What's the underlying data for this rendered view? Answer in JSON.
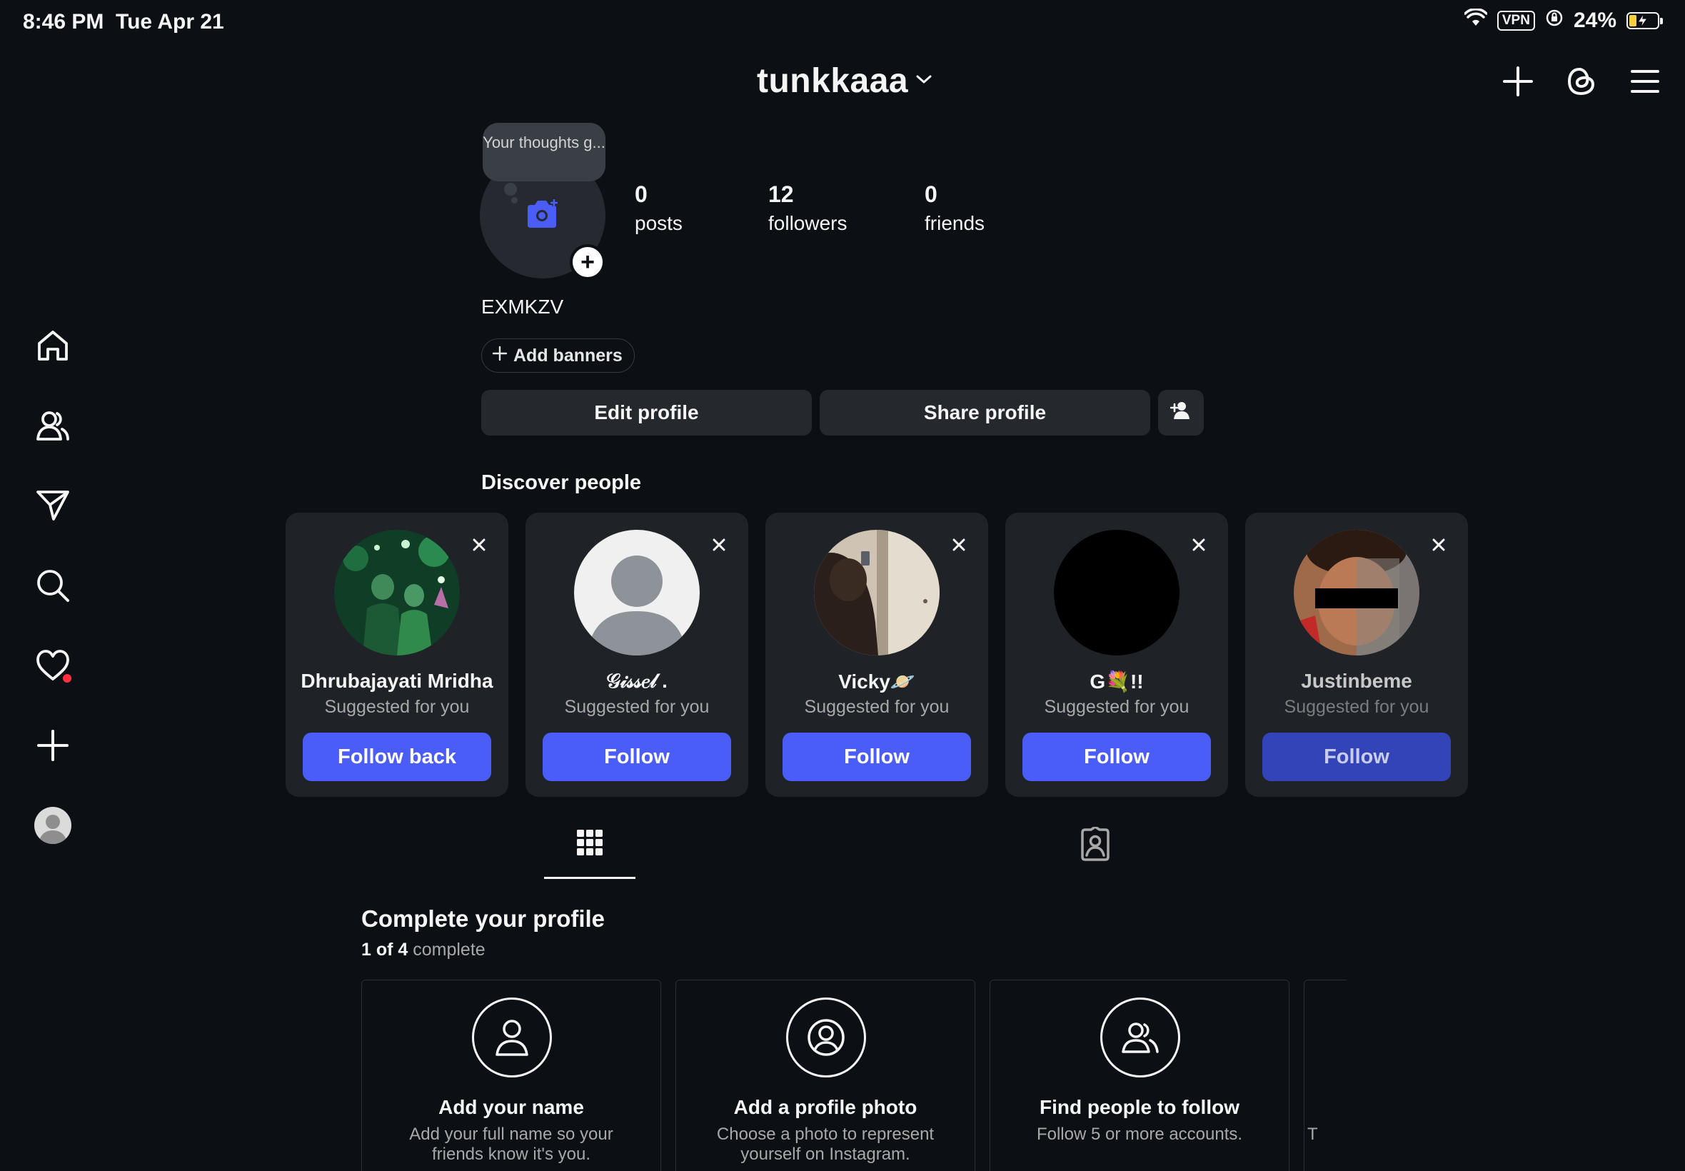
{
  "status_bar": {
    "time": "8:46 PM",
    "date": "Tue Apr 21",
    "vpn_label": "VPN",
    "battery_percent": "24%",
    "battery_level": 0.24,
    "icons": [
      "wifi-icon",
      "vpn-icon",
      "orientation-lock-icon",
      "battery-charging-icon"
    ]
  },
  "header": {
    "username": "tunkkaaa",
    "icons": [
      "plus-icon",
      "threads-icon",
      "menu-icon"
    ]
  },
  "rail": {
    "items": [
      "home-icon",
      "people-icon",
      "messages-icon",
      "search-icon",
      "notifications-heart-icon",
      "create-plus-icon",
      "profile-avatar"
    ],
    "notification_dot_color": "#ff3040"
  },
  "profile": {
    "note_placeholder": "Your thoughts g...",
    "stats": [
      {
        "num": "0",
        "label": "posts"
      },
      {
        "num": "12",
        "label": "followers"
      },
      {
        "num": "0",
        "label": "friends"
      }
    ],
    "display_name": "EXMKZV",
    "add_banners": "Add banners",
    "edit_profile": "Edit profile",
    "share_profile": "Share profile"
  },
  "discover": {
    "title": "Discover people",
    "cards": [
      {
        "name": "Dhrubajayati Mridha",
        "sub": "Suggested for you",
        "button": "Follow back"
      },
      {
        "name": "𝒢𝒾𝓈𝓈𝑒𝓁 .",
        "sub": "Suggested for you",
        "button": "Follow"
      },
      {
        "name": "Vicky🪐",
        "sub": "Suggested for you",
        "button": "Follow"
      },
      {
        "name": "G💐!!",
        "sub": "Suggested for you",
        "button": "Follow"
      },
      {
        "name": "Justinbeme",
        "sub": "Suggested for you",
        "button": "Follow"
      }
    ]
  },
  "tabs": [
    "posts-grid-icon",
    "tagged-icon"
  ],
  "complete_profile": {
    "title": "Complete your profile",
    "progress_done": "1 of 4",
    "progress_word": "complete",
    "cards": [
      {
        "title": "Add your name",
        "desc": "Add your full name so your friends know it's you."
      },
      {
        "title": "Add a profile photo",
        "desc": "Choose a photo to represent yourself on Instagram."
      },
      {
        "title": "Find people to follow",
        "desc": "Follow 5 or more accounts."
      },
      {
        "title": "",
        "desc": "T"
      }
    ]
  },
  "colors": {
    "background": "#0c1014",
    "accent": "#4a5df9",
    "card": "#1f2327"
  }
}
